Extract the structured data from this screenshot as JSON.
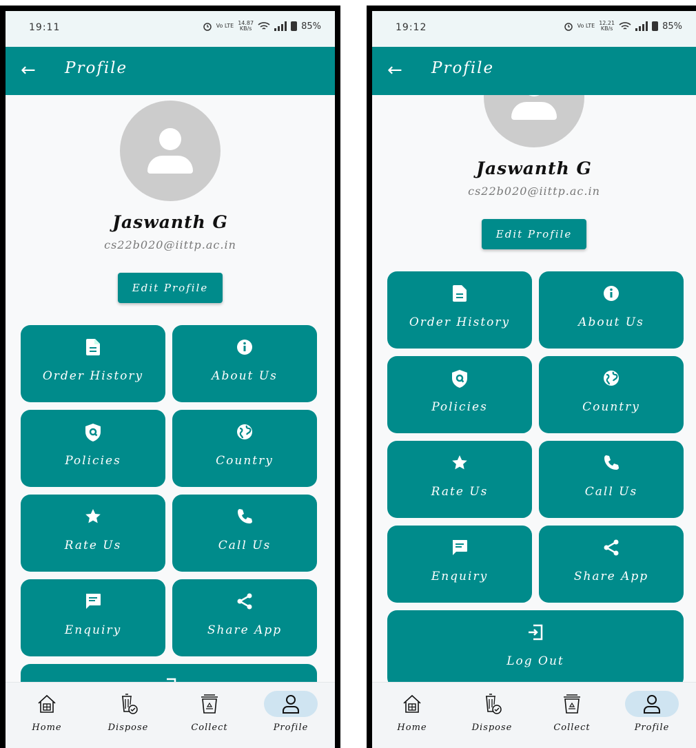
{
  "colors": {
    "primary": "#008b8b",
    "status_bg": "#eef6f7",
    "avatar": "#cccccc",
    "active_pill": "#cfe4f1"
  },
  "screens": [
    {
      "status": {
        "time": "19:11",
        "net_top": "14.87",
        "net_bottom": "KB/s",
        "sim": "Vo LTE",
        "battery": "85%"
      },
      "title": "Profile"
    },
    {
      "status": {
        "time": "19:12",
        "net_top": "12.21",
        "net_bottom": "KB/s",
        "sim": "Vo LTE",
        "battery": "85%"
      },
      "title": "Profile"
    }
  ],
  "profile": {
    "name": "Jaswanth G",
    "email": "cs22b020@iittp.ac.in",
    "edit_label": "Edit Profile"
  },
  "menu": [
    {
      "label": "Order History",
      "icon": "document-icon"
    },
    {
      "label": "About Us",
      "icon": "info-icon"
    },
    {
      "label": "Policies",
      "icon": "shield-icon"
    },
    {
      "label": "Country",
      "icon": "globe-icon"
    },
    {
      "label": "Rate Us",
      "icon": "star-icon"
    },
    {
      "label": "Call Us",
      "icon": "phone-icon"
    },
    {
      "label": "Enquiry",
      "icon": "message-icon"
    },
    {
      "label": "Share App",
      "icon": "share-icon"
    },
    {
      "label": "Log Out",
      "icon": "logout-icon"
    }
  ],
  "nav": [
    {
      "label": "Home",
      "icon": "home-icon"
    },
    {
      "label": "Dispose",
      "icon": "trash-icon"
    },
    {
      "label": "Collect",
      "icon": "recycle-bin-icon"
    },
    {
      "label": "Profile",
      "icon": "person-icon",
      "active": true
    }
  ]
}
